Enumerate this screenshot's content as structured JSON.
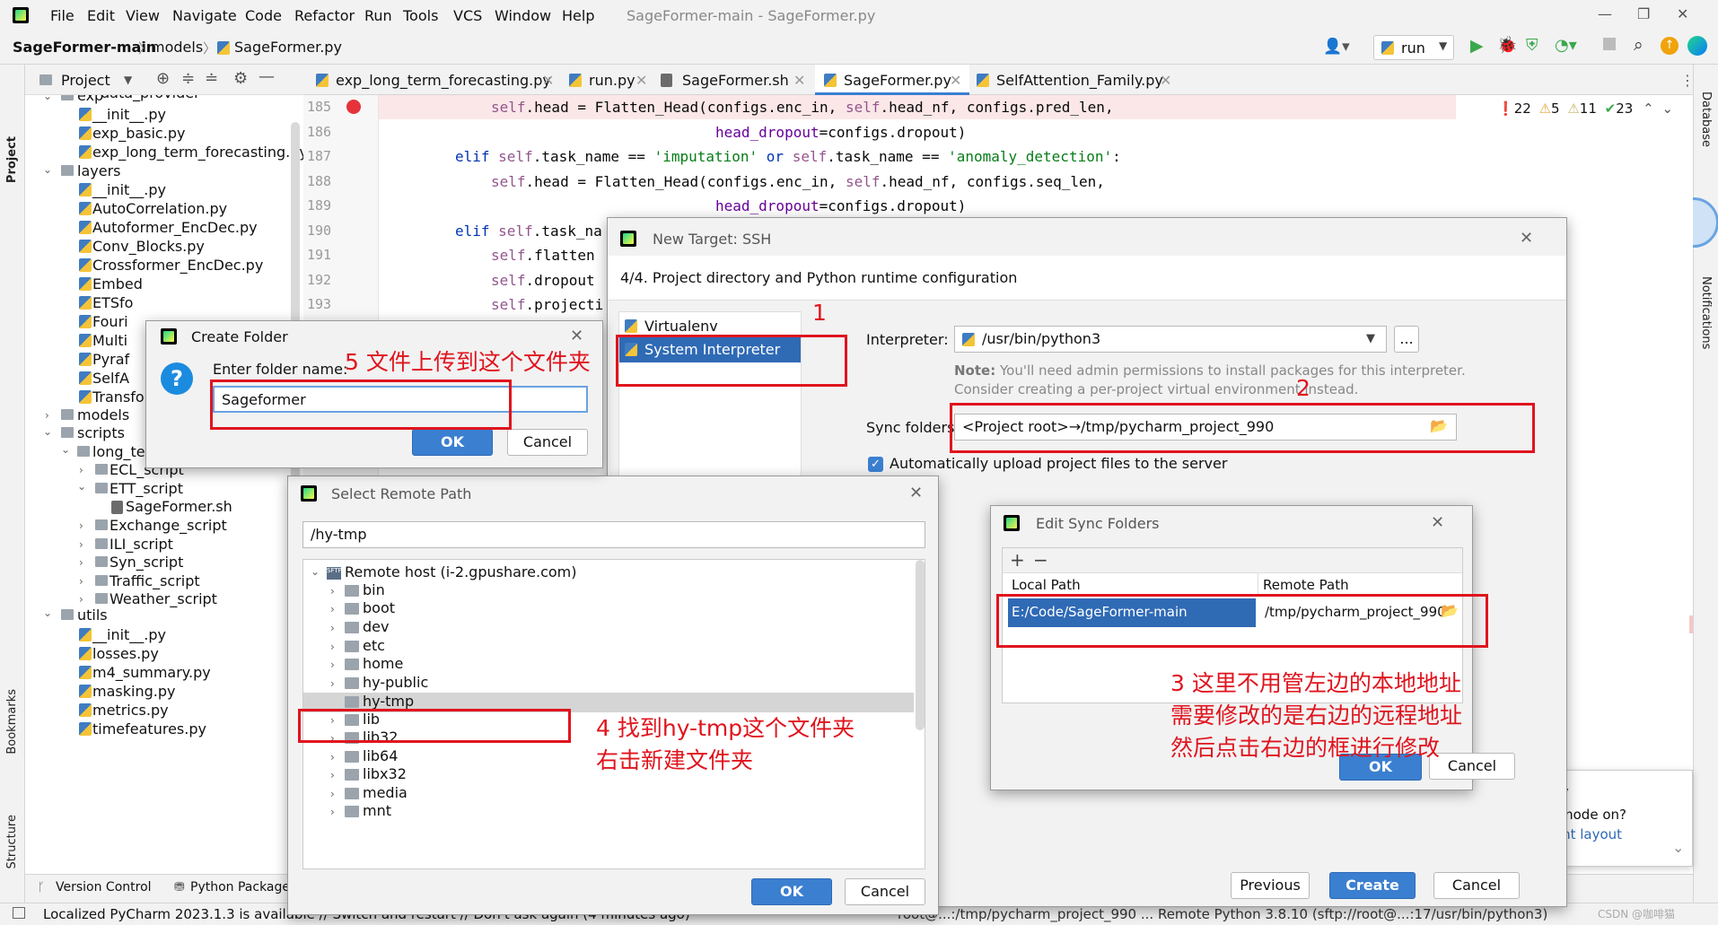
{
  "menu": {
    "items": [
      "File",
      "Edit",
      "View",
      "Navigate",
      "Code",
      "Refactor",
      "Run",
      "Tools",
      "VCS",
      "Window",
      "Help"
    ],
    "window_title": "SageFormer-main - SageFormer.py"
  },
  "nav": {
    "project": "SageFormer-main",
    "folder": "models",
    "file": "SageFormer.py",
    "run_config": "run"
  },
  "side": {
    "left_top": "Project",
    "left_bookmarks": "Bookmarks",
    "left_structure": "Structure",
    "right_database": "Database",
    "right_notifications": "Notifications"
  },
  "project_panel": {
    "title": "Project",
    "items": [
      "data_provider",
      "exp",
      "__init__.py",
      "exp_basic.py",
      "exp_long_term_forecasting.py",
      "layers",
      "__init__.py",
      "AutoCorrelation.py",
      "Autoformer_EncDec.py",
      "Conv_Blocks.py",
      "Crossformer_EncDec.py",
      "Embed",
      "ETSfo",
      "Fouri",
      "Multi",
      "Pyraf",
      "SelfA",
      "Transformer_EncDec.py",
      "models",
      "scripts",
      "long_term_forecast",
      "ECL_script",
      "ETT_script",
      "SageFormer.sh",
      "Exchange_script",
      "ILI_script",
      "Syn_script",
      "Traffic_script",
      "Weather_script",
      "utils",
      "__init__.py",
      "losses.py",
      "m4_summary.py",
      "masking.py",
      "metrics.py",
      "timefeatures.py"
    ]
  },
  "tabs": [
    "exp_long_term_forecasting.py",
    "run.py",
    "SageFormer.sh",
    "SageFormer.py",
    "SelfAttention_Family.py"
  ],
  "inspections": {
    "errors": "22",
    "warnings": "5",
    "weak": "11",
    "ok": "23"
  },
  "code": {
    "lines": [
      "185",
      "186",
      "187",
      "188",
      "189",
      "190",
      "191",
      "192",
      "193"
    ],
    "l185_a": "self",
    "l185_b": ".head = Flatten_Head(configs.enc_in, ",
    "l185_c": "self",
    "l185_d": ".head_nf, configs.pred_len,",
    "l186_a": "head_dropout",
    "l186_b": "=configs.dropout)",
    "l187_a": "elif ",
    "l187_b": "self",
    "l187_c": ".task_name == ",
    "l187_d": "'imputation'",
    "l187_e": " or ",
    "l187_f": "self",
    "l187_g": ".task_name == ",
    "l187_h": "'anomaly_detection'",
    "l187_i": ":",
    "l188_a": "self",
    "l188_b": ".head = Flatten_Head(configs.enc_in, ",
    "l188_c": "self",
    "l188_d": ".head_nf, configs.seq_len,",
    "l189_a": "head_dropout",
    "l189_b": "=configs.dropout)",
    "l190_a": "elif ",
    "l190_b": "self",
    "l190_c": ".task_na",
    "l191_a": "self",
    "l191_b": ".flatten",
    "l192_a": "self",
    "l192_b": ".dropout",
    "l193_a": "self",
    "l193_b": ".projecti"
  },
  "bottom": {
    "version_control": "Version Control",
    "python_packages": "Python Packages",
    "status": "Localized PyCharm 2023.1.3 is available // Switch and restart // Don't ask again (4 minutes ago)",
    "status_right": "root@...:/tmp/pycharm_project_990 ... Remote Python 3.8.10 (sftp://root@...:17/usr/bin/python3)"
  },
  "ssh_dialog": {
    "title": "New Target: SSH",
    "subtitle": "4/4. Project directory and Python runtime configuration",
    "opt_virtualenv": "Virtualenv Environment",
    "opt_system": "System Interpreter",
    "interpreter_label": "Interpreter:",
    "interpreter_value": "/usr/bin/python3",
    "browse": "...",
    "note_bold": "Note:",
    "note_text": " You'll need admin permissions to install packages for this interpreter. Consider creating a per-project virtual environment instead.",
    "sync_label": "Sync folders:",
    "sync_value": "<Project root>→/tmp/pycharm_project_990",
    "auto_upload": "Automatically upload project files to the server",
    "previous": "Previous",
    "create": "Create",
    "cancel": "Cancel"
  },
  "sync_dialog": {
    "title": "Edit Sync Folders",
    "add": "+",
    "remove": "−",
    "col_local": "Local Path",
    "col_remote": "Remote Path",
    "local": "E:/Code/SageFormer-main",
    "remote": "/tmp/pycharm_project_990",
    "ok": "OK",
    "cancel": "Cancel"
  },
  "remote_dialog": {
    "title": "Select Remote Path",
    "path": "/hy-tmp",
    "root": "Remote host (i-2.gpushare.com)",
    "folders": [
      "bin",
      "boot",
      "dev",
      "etc",
      "home",
      "hy-public",
      "hy-tmp",
      "lib",
      "lib32",
      "lib64",
      "libx32",
      "media",
      "mnt"
    ],
    "ok": "OK",
    "cancel": "Cancel"
  },
  "folder_dialog": {
    "title": "Create Folder",
    "label": "Enter folder name:",
    "value": "Sageformer",
    "ok": "OK",
    "cancel": "Cancel"
  },
  "popup": {
    "title": "Py",
    "line1": "c mode on?",
    "line2": "rent layout"
  },
  "annotations": {
    "a1": "1",
    "a2": "2",
    "a3_l1": "3  这里不用管左边的本地地址",
    "a3_l2": "需要修改的是右边的远程地址",
    "a3_l3": "然后点击右边的框进行修改",
    "a4_l1": "4 找到hy-tmp这个文件夹",
    "a4_l2": "右击新建文件夹",
    "a5": "5 文件上传到这个文件夹"
  },
  "watermark": "CSDN @咖啡猫"
}
